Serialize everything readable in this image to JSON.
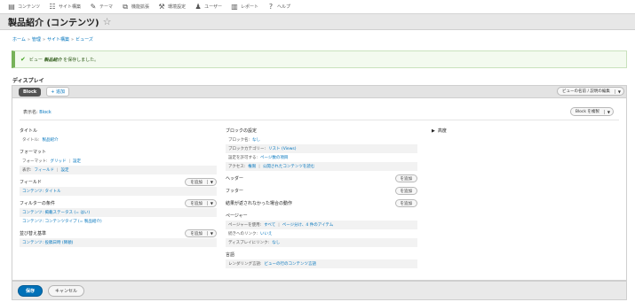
{
  "toolbar": {
    "items": [
      {
        "icon": "content-icon",
        "label": "コンテンツ"
      },
      {
        "icon": "structure-icon",
        "label": "サイト構築"
      },
      {
        "icon": "appearance-icon",
        "label": "テーマ"
      },
      {
        "icon": "extend-icon",
        "label": "機能拡張"
      },
      {
        "icon": "config-icon",
        "label": "環境設定"
      },
      {
        "icon": "people-icon",
        "label": "ユーザー"
      },
      {
        "icon": "reports-icon",
        "label": "レポート"
      },
      {
        "icon": "help-icon",
        "label": "ヘルプ"
      }
    ]
  },
  "header": {
    "title": "製品紹介 (コンテンツ)",
    "star": "☆"
  },
  "breadcrumb": [
    "ホーム",
    "管理",
    "サイト構築",
    "ビューズ"
  ],
  "message": {
    "prefix": "ビュー",
    "name": "製品紹介",
    "suffix": "を保存しました。"
  },
  "displays": {
    "title": "ディスプレイ",
    "active_tab": "Block",
    "add_label": "追加",
    "edit_view_label": "ビューの名前 / 説明の編集"
  },
  "panel": {
    "name_label": "表示名:",
    "name_value": "Block",
    "block_edit_label": "Block を複製",
    "first": {
      "title_section": "タイトル",
      "title_row_label": "タイトル:",
      "title_row_value": "製品紹介",
      "format_section": "フォーマット",
      "format_label": "フォーマット:",
      "format_value": "グリッド",
      "format_settings": "設定",
      "show_label": "表示:",
      "show_value": "フィールド",
      "show_settings": "設定",
      "fields_section": "フィールド",
      "fields_add": "を追加",
      "fields_row": "コンテンツ: タイトル",
      "filter_section": "フィルターの条件",
      "filter_add": "を追加",
      "filter_row1": "コンテンツ: 掲載ステータス (= はい)",
      "filter_row2": "コンテンツ: コンテンツタイプ (= 製品紹介)",
      "sort_section": "並び替え基準",
      "sort_add": "を追加",
      "sort_row": "コンテンツ: 投稿日時 (降順)"
    },
    "second": {
      "block_section": "ブロックの設定",
      "block_name_label": "ブロック名:",
      "block_name_value": "なし",
      "block_category_label": "ブロックカテゴリー:",
      "block_category_value": "リスト (Views)",
      "allow_label": "設定を許可する:",
      "allow_value": "ページ数の項目",
      "access_label": "アクセス:",
      "access_value": "権限",
      "access_extra": "公開されたコンテンツを読む",
      "header_section": "ヘッダー",
      "header_add": "を追加",
      "footer_section": "フッター",
      "footer_add": "を追加",
      "noresult_section": "結果が返されなかった場合の動作",
      "noresult_add": "を追加",
      "pager_section": "ページャー",
      "pager_label": "ページャーを使用:",
      "pager_value": "すべて",
      "pager_extra": "ページ分け、4 件のアイテム",
      "more_label": "続きへのリンク:",
      "more_value": "いいえ",
      "display_more_label": "ディスプレイにリンク:",
      "display_more_value": "なし",
      "language_section": "言語",
      "render_label": "レンダリング言語:",
      "render_value": "ビューの行のコンテンツ言語"
    },
    "third": {
      "advanced": "高度"
    }
  },
  "footer": {
    "save": "保存",
    "cancel": "キャンセル"
  }
}
